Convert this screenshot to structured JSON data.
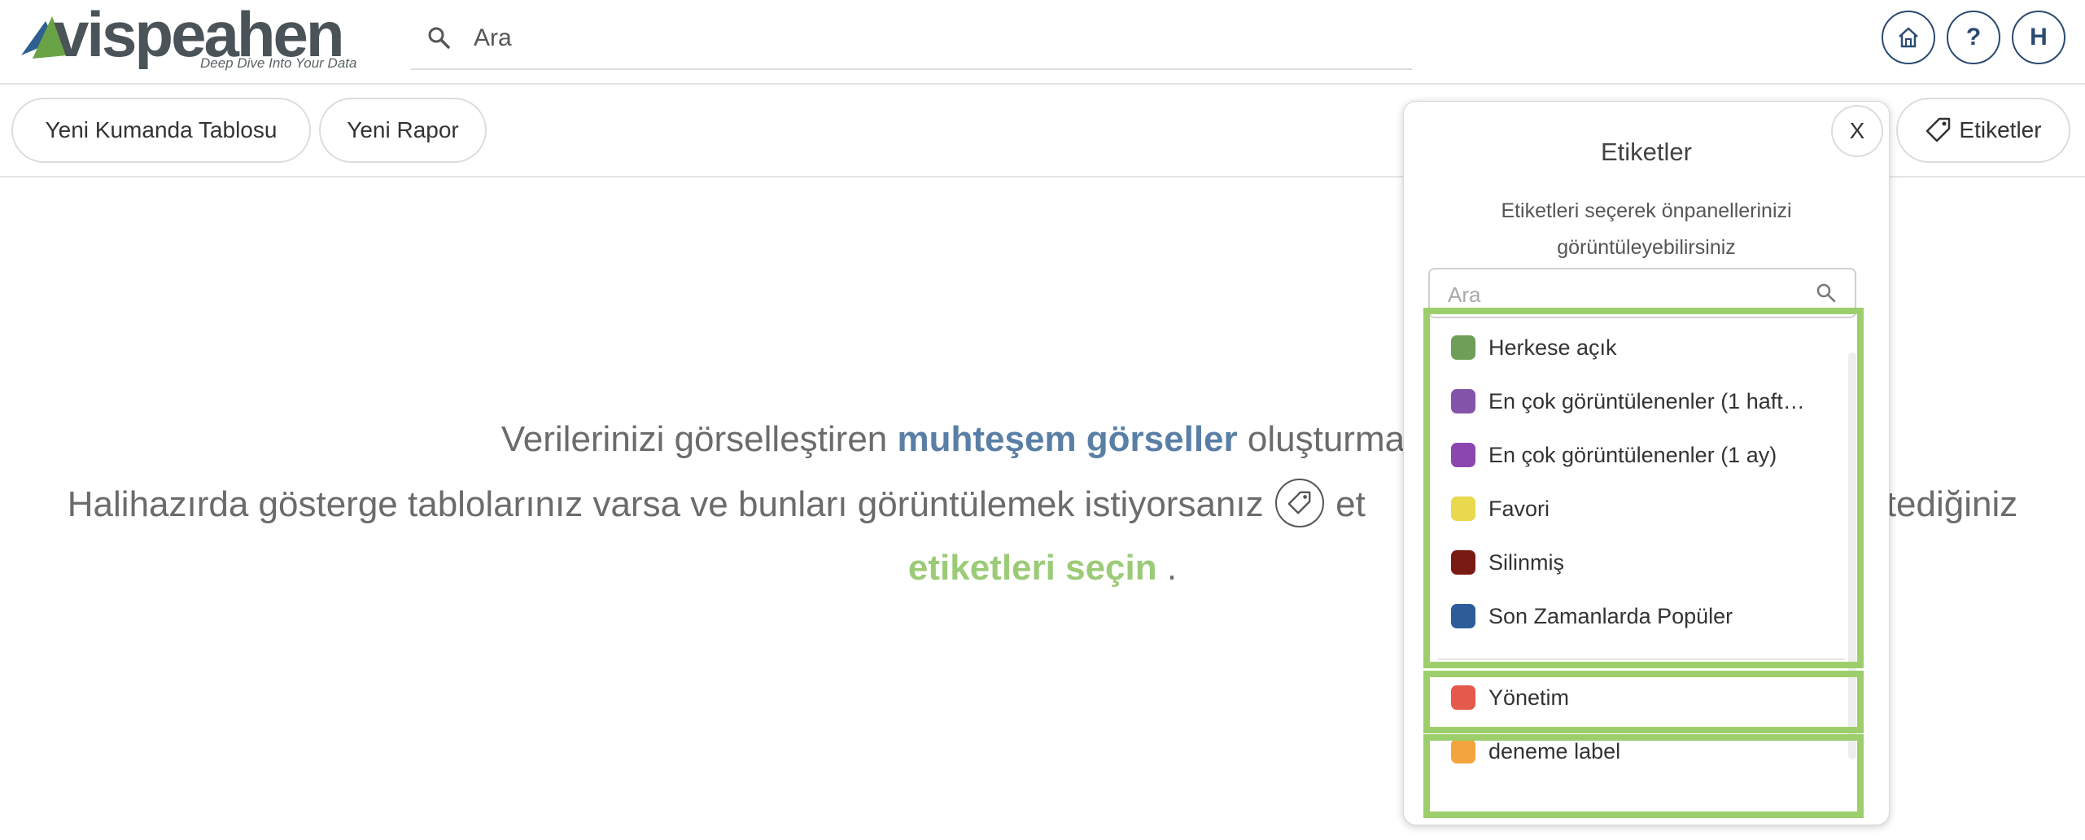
{
  "header": {
    "logo_text": "vispeahen",
    "logo_tagline": "Deep Dive Into Your Data",
    "search_placeholder": "Ara",
    "user_initial": "H",
    "help_label": "?"
  },
  "toolbar": {
    "new_dashboard": "Yeni Kumanda Tablosu",
    "new_report": "Yeni Rapor",
    "tags_button": "Etiketler"
  },
  "message": {
    "l1_a": "Verilerinizi görselleştiren",
    "l1_b": "muhteşem görseller",
    "l1_c": "oluşturmak istiyorsan",
    "l2_a": "Halihazırda gösterge tablolarınız varsa ve bunları görüntülemek istiyorsanız",
    "l2_b": "et",
    "l2_c": "tediğiniz",
    "l3_a": "etiketleri seçin",
    "l3_b": "."
  },
  "panel": {
    "close_label": "X",
    "title": "Etiketler",
    "description": "Etiketleri seçerek önpanellerinizi görüntüleyebilirsiniz",
    "search_placeholder": "Ara",
    "tags": [
      {
        "label": "Herkese açık",
        "color": "#6e9e57"
      },
      {
        "label": "En çok görüntülenenler (1 haft…",
        "color": "#8354a8"
      },
      {
        "label": "En çok görüntülenenler (1 ay)",
        "color": "#8b46b0"
      },
      {
        "label": "Favori",
        "color": "#e8d94e"
      },
      {
        "label": "Silinmiş",
        "color": "#7a1a14"
      },
      {
        "label": "Son Zamanlarda Popüler",
        "color": "#2c5d98"
      },
      {
        "label": "Yönetim",
        "color": "#e45a4c"
      },
      {
        "label": "deneme label",
        "color": "#f3a43e"
      }
    ]
  },
  "colors": {
    "accent_blue": "#2b4b72",
    "highlight_green": "#9ccf6c",
    "text_blue": "#5a7fa6"
  }
}
